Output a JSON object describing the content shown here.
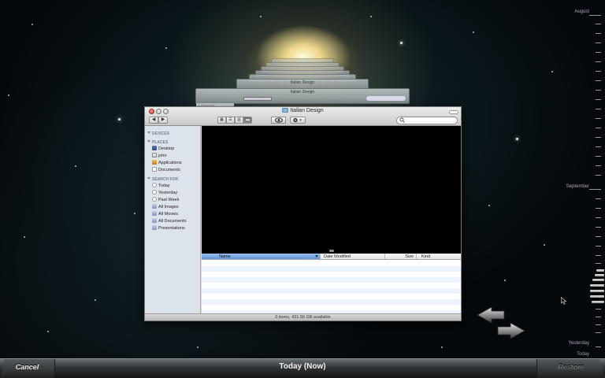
{
  "finder": {
    "title": "Italian Design",
    "nav": {
      "back": "◀",
      "forward": "▶"
    },
    "view_buttons": [
      "▦",
      "☰",
      "▥",
      "▬"
    ],
    "quicklook_icon": "eye-icon",
    "action_icon": "gear-icon",
    "search_placeholder": "",
    "sidebar": {
      "devices_header": "DEVICES",
      "places_header": "PLACES",
      "places": [
        {
          "label": "Desktop",
          "icon": "desktop-icon"
        },
        {
          "label": "john",
          "icon": "home-icon"
        },
        {
          "label": "Applications",
          "icon": "applications-icon"
        },
        {
          "label": "Documents",
          "icon": "documents-icon"
        }
      ],
      "search_header": "SEARCH FOR",
      "search_items": [
        {
          "label": "Today",
          "icon": "clock-icon"
        },
        {
          "label": "Yesterday",
          "icon": "clock-icon"
        },
        {
          "label": "Past Week",
          "icon": "clock-icon"
        },
        {
          "label": "All Images",
          "icon": "smart-folder-icon"
        },
        {
          "label": "All Movies",
          "icon": "smart-folder-icon"
        },
        {
          "label": "All Documents",
          "icon": "smart-folder-icon"
        },
        {
          "label": "Presentations",
          "icon": "smart-folder-icon"
        }
      ]
    },
    "columns": {
      "name": "Name",
      "date": "Date Modified",
      "size": "Size",
      "kind": "Kind"
    },
    "status": "0 items, 431.56 GB available"
  },
  "stack_windows": {
    "title_small": "Italian Design",
    "title_back": "Italian Design",
    "devices_label": "▸ DEVICES"
  },
  "timeline": {
    "labels": {
      "august": "August",
      "september": "September",
      "yesterday": "Yesterday",
      "today": "Today"
    }
  },
  "bottom_bar": {
    "cancel": "Cancel",
    "title": "Today (Now)",
    "restore": "Restore"
  },
  "colors": {
    "sidebar_bg": "#dde3ea",
    "selected_column": "#5f94d8",
    "row_stripe": "#edf3fe"
  }
}
